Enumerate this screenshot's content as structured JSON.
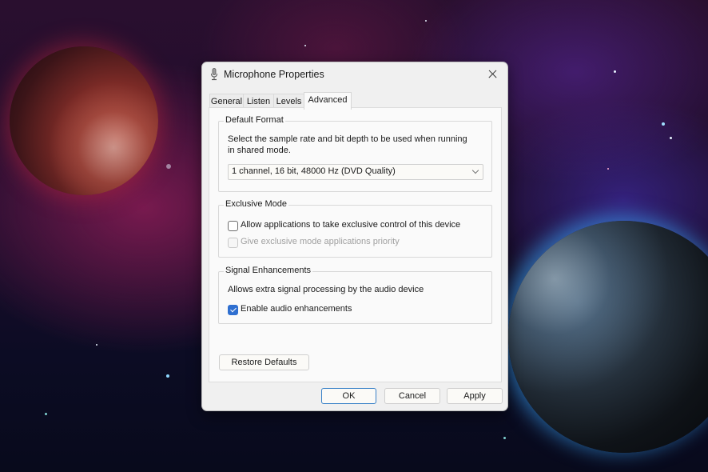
{
  "window": {
    "title": "Microphone Properties",
    "icon": "microphone-icon",
    "close_icon": "close-icon"
  },
  "tabs": [
    {
      "label": "General",
      "active": false
    },
    {
      "label": "Listen",
      "active": false
    },
    {
      "label": "Levels",
      "active": false
    },
    {
      "label": "Advanced",
      "active": true
    }
  ],
  "default_format": {
    "title": "Default Format",
    "description_line1": "Select the sample rate and bit depth to be used when running",
    "description_line2": "in shared mode.",
    "selected_format": "1 channel, 16 bit, 48000 Hz (DVD Quality)"
  },
  "exclusive_mode": {
    "title": "Exclusive Mode",
    "allow_exclusive": {
      "label": "Allow applications to take exclusive control of this device",
      "checked": false,
      "enabled": true
    },
    "give_priority": {
      "label": "Give exclusive mode applications priority",
      "checked": false,
      "enabled": false
    }
  },
  "signal_enhancements": {
    "title": "Signal Enhancements",
    "description": "Allows extra signal processing by the audio device",
    "enable_enhancements": {
      "label": "Enable audio enhancements",
      "checked": true,
      "enabled": true
    }
  },
  "buttons": {
    "restore_defaults": "Restore Defaults",
    "ok": "OK",
    "cancel": "Cancel",
    "apply": "Apply"
  },
  "colors": {
    "accent": "#2f6fd0",
    "default_button_border": "#3a82c8"
  }
}
